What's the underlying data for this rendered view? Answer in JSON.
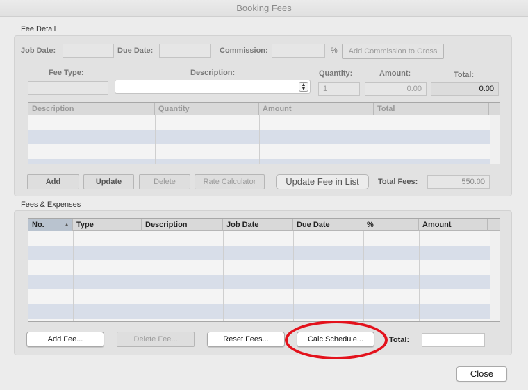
{
  "window": {
    "title": "Booking Fees"
  },
  "fee_detail": {
    "section_label": "Fee Detail",
    "job_date_label": "Job Date:",
    "job_date_value": "",
    "due_date_label": "Due Date:",
    "due_date_value": "",
    "commission_label": "Commission:",
    "commission_value": "",
    "percent_sign": "%",
    "add_commission_button": "Add Commission to Gross",
    "fee_type_label": "Fee Type:",
    "fee_type_value": "",
    "description_label": "Description:",
    "description_value": "",
    "quantity_label": "Quantity:",
    "quantity_value": "1",
    "amount_label": "Amount:",
    "amount_value": "0.00",
    "total_label": "Total:",
    "total_value": "0.00",
    "table": {
      "columns": [
        "Description",
        "Quantity",
        "Amount",
        "Total"
      ],
      "rows": []
    },
    "buttons": {
      "add": "Add",
      "update": "Update",
      "delete": "Delete",
      "rate_calculator": "Rate Calculator",
      "update_fee_in_list": "Update Fee in List"
    },
    "total_fees_label": "Total Fees:",
    "total_fees_value": "550.00"
  },
  "fees_expenses": {
    "section_label": "Fees & Expenses",
    "table": {
      "columns": [
        "No.",
        "Type",
        "Description",
        "Job Date",
        "Due Date",
        "%",
        "Amount"
      ],
      "sorted_column": "No.",
      "rows": []
    },
    "buttons": {
      "add_fee": "Add Fee...",
      "delete_fee": "Delete Fee...",
      "reset_fees": "Reset Fees...",
      "calc_schedule": "Calc Schedule..."
    },
    "total_label": "Total:",
    "total_value": ""
  },
  "close_button": "Close",
  "colors": {
    "highlight": "#e3121c",
    "row_stripe": "#d8dee9"
  }
}
